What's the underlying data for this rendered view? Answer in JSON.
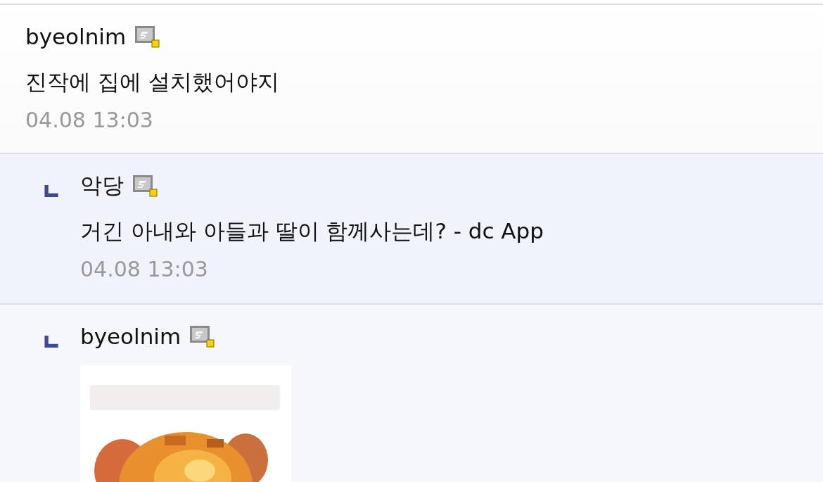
{
  "comments": [
    {
      "reply": false,
      "author": "byeolnim",
      "kind": "text",
      "text": "진작에 집에 설치했어야지",
      "date": "04.08 13:03"
    },
    {
      "reply": true,
      "author": "악당",
      "kind": "text",
      "text": "거긴 아내와 아들과 딸이 함께사는데? - dc App",
      "date": "04.08 13:03"
    },
    {
      "reply": true,
      "author": "byeolnim",
      "kind": "picture"
    }
  ]
}
